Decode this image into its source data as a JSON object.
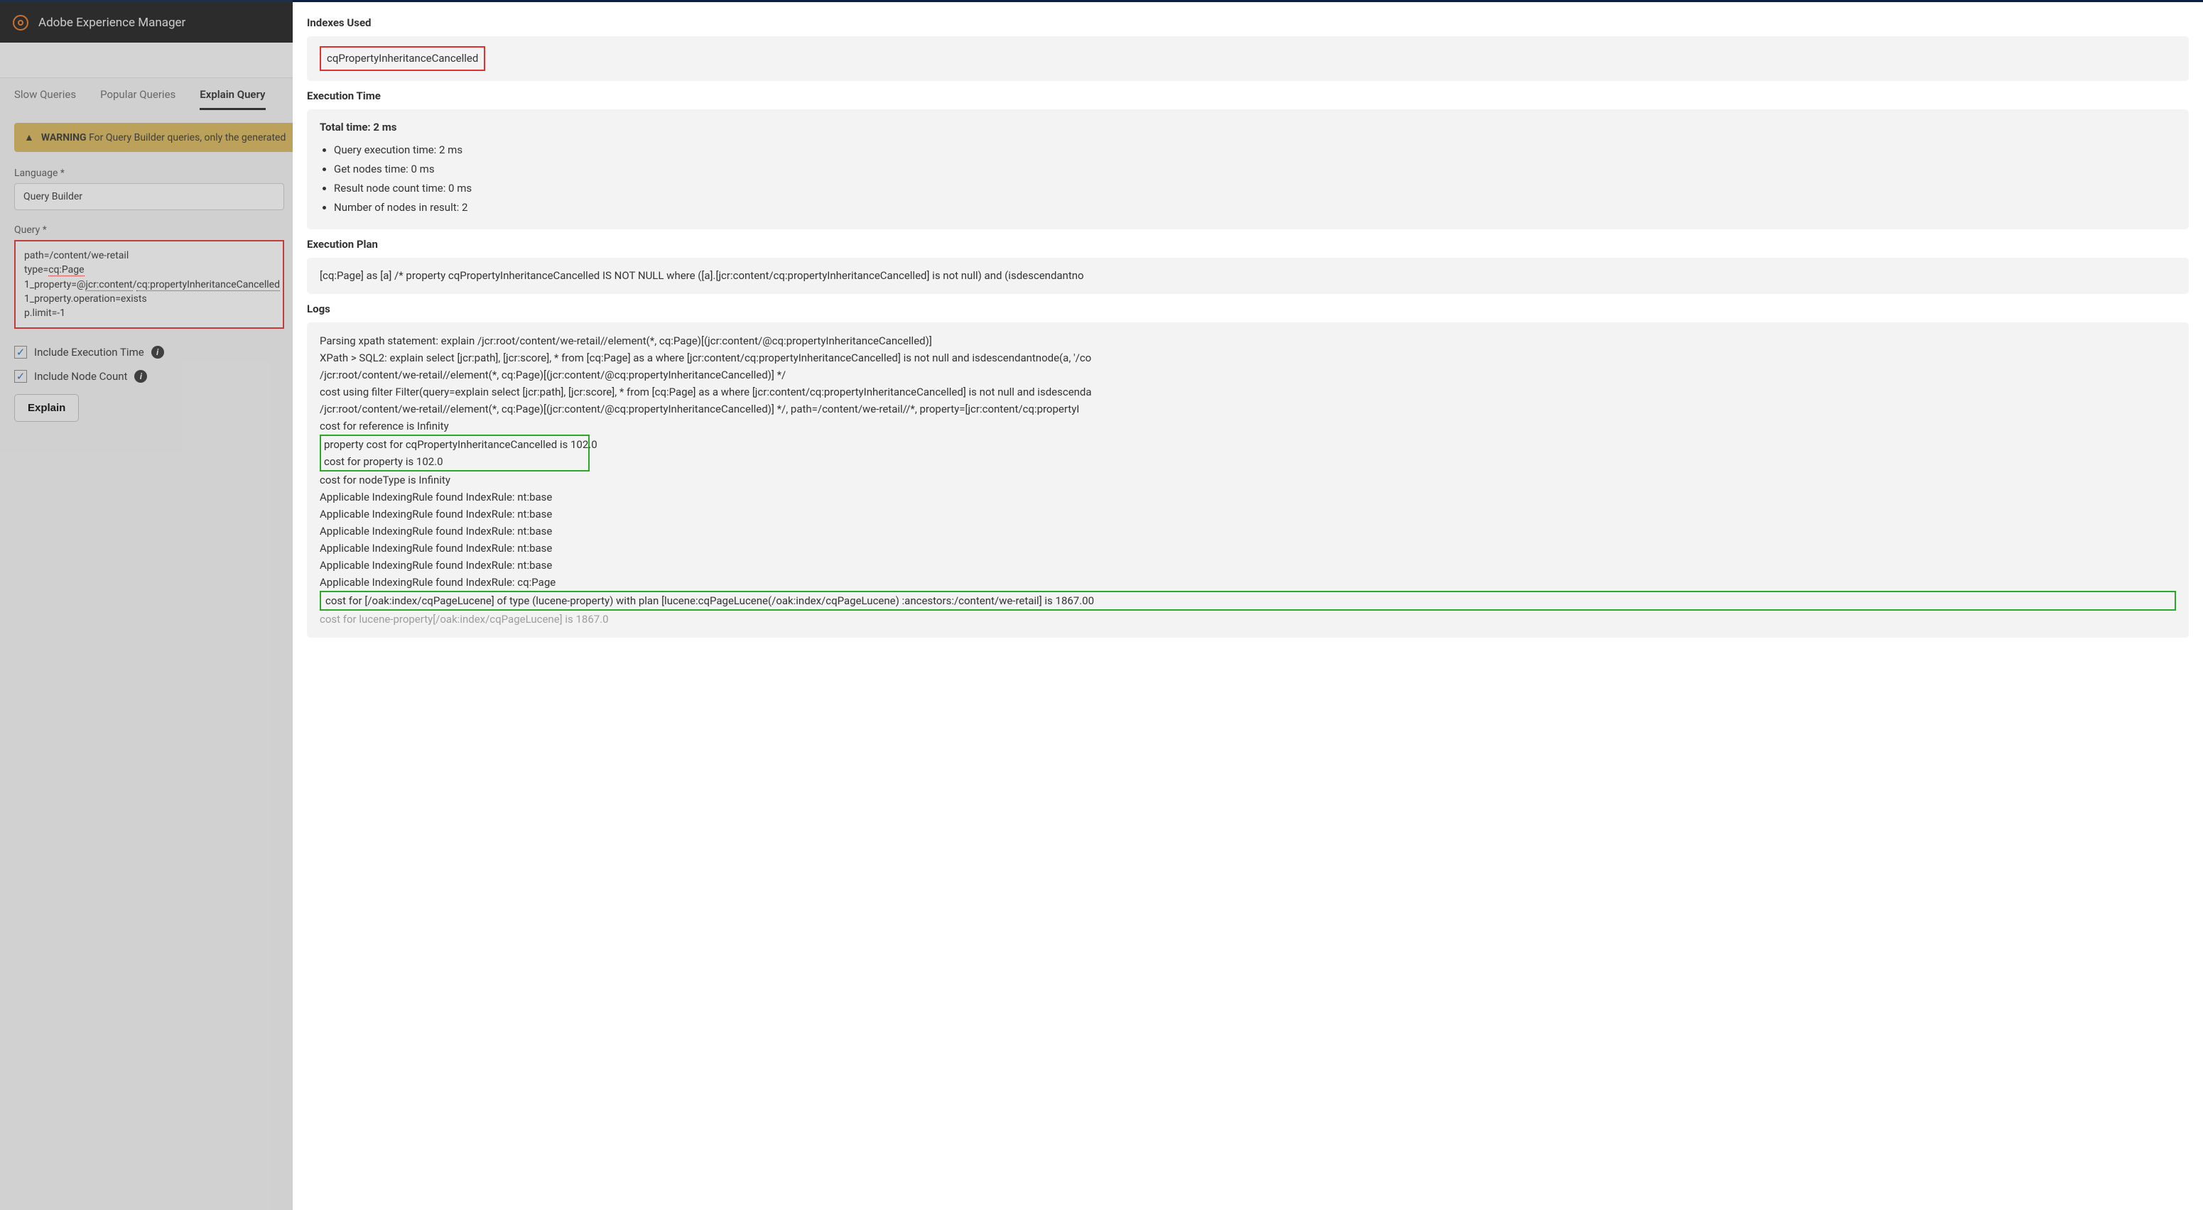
{
  "header": {
    "title": "Adobe Experience Manager"
  },
  "tabs": {
    "slow": "Slow Queries",
    "popular": "Popular Queries",
    "explain": "Explain Query"
  },
  "warning": {
    "label": "WARNING",
    "text": "For Query Builder queries, only the generated"
  },
  "form": {
    "languageLabel": "Language *",
    "languageValue": "Query Builder",
    "queryLabel": "Query *",
    "queryLines": {
      "l1": "path=/content/we-retail",
      "l2a": "type=",
      "l2b": "cq:Page",
      "l3a": "1_property=@",
      "l3b": "jcr:content",
      "l3c": "/",
      "l3d": "cq:propertyInheritanceCancelled",
      "l4": "1_property.operation=exists",
      "l5": "p.limit=-1"
    },
    "includeExecTime": "Include Execution Time",
    "includeNodeCount": "Include Node Count",
    "explainBtn": "Explain"
  },
  "results": {
    "indexesUsed": {
      "title": "Indexes Used",
      "value": "cqPropertyInheritanceCancelled"
    },
    "execTime": {
      "title": "Execution Time",
      "totalLabel": "Total time: 2 ms",
      "bullets": {
        "b1": "Query execution time: 2 ms",
        "b2": "Get nodes time: 0 ms",
        "b3": "Result node count time: 0 ms",
        "b4": "Number of nodes in result: 2"
      }
    },
    "plan": {
      "title": "Execution Plan",
      "text": "[cq:Page] as [a] /* property cqPropertyInheritanceCancelled IS NOT NULL where ([a].[jcr:content/cq:propertyInheritanceCancelled] is not null) and (isdescendantno"
    },
    "logs": {
      "title": "Logs",
      "l1": "Parsing xpath statement: explain /jcr:root/content/we-retail//element(*, cq:Page)[(jcr:content/@cq:propertyInheritanceCancelled)]",
      "l2": "XPath > SQL2: explain select [jcr:path], [jcr:score], * from [cq:Page] as a where [jcr:content/cq:propertyInheritanceCancelled] is not null and isdescendantnode(a, '/co",
      "l3": "/jcr:root/content/we-retail//element(*, cq:Page)[(jcr:content/@cq:propertyInheritanceCancelled)] */",
      "l4": "cost using filter Filter(query=explain select [jcr:path], [jcr:score], * from [cq:Page] as a where [jcr:content/cq:propertyInheritanceCancelled] is not null and isdescenda",
      "l5": "/jcr:root/content/we-retail//element(*, cq:Page)[(jcr:content/@cq:propertyInheritanceCancelled)] */, path=/content/we-retail//*, property=[jcr:content/cq:propertyI",
      "l6": "cost for reference is Infinity",
      "l7a": "property cost for cqPropertyInheritanceCancelled is 102.0",
      "l7b": "cost for property is 102.0",
      "l8": "cost for nodeType is Infinity",
      "l9": "Applicable IndexingRule found IndexRule: nt:base",
      "l10": "Applicable IndexingRule found IndexRule: nt:base",
      "l11": "Applicable IndexingRule found IndexRule: nt:base",
      "l12": "Applicable IndexingRule found IndexRule: nt:base",
      "l13": "Applicable IndexingRule found IndexRule: nt:base",
      "l14": "Applicable IndexingRule found IndexRule: cq:Page",
      "l15": "cost for [/oak:index/cqPageLucene] of type (lucene-property) with plan [lucene:cqPageLucene(/oak:index/cqPageLucene) :ancestors:/content/we-retail] is 1867.00",
      "l16": "cost for lucene-property[/oak:index/cqPageLucene] is 1867.0"
    }
  }
}
